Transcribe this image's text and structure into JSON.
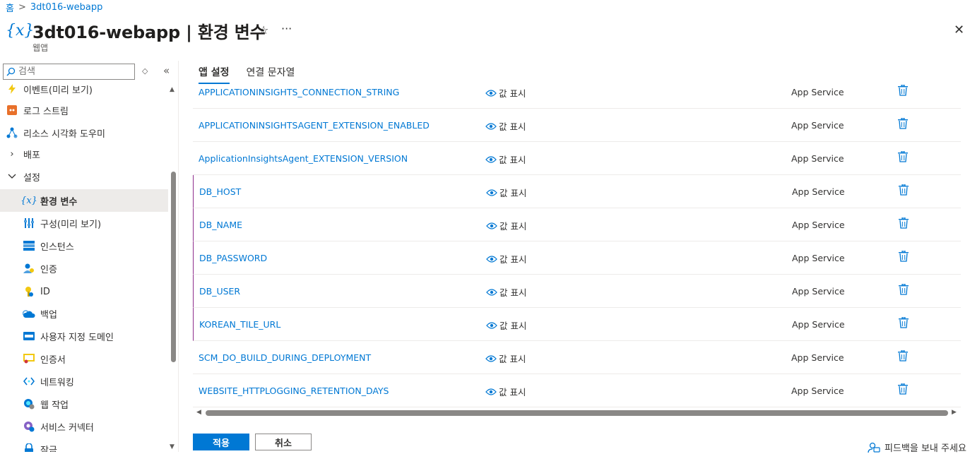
{
  "breadcrumb": {
    "home": "홈",
    "separator": ">",
    "current": "3dt016-webapp"
  },
  "header": {
    "icon_glyph": "{x}",
    "title": "3dt016-webapp | 환경 변수",
    "subtitle": "웹앱",
    "star_glyph": "☆",
    "more_glyph": "···",
    "close_glyph": "✕"
  },
  "search": {
    "placeholder": "검색"
  },
  "nav": {
    "items": [
      {
        "label": "이벤트(미리 보기)",
        "icon": "lightning-icon"
      },
      {
        "label": "로그 스트림",
        "icon": "log-stream-icon"
      },
      {
        "label": "리소스 시각화 도우미",
        "icon": "resource-visualizer-icon"
      },
      {
        "label": "배포",
        "icon": "chevron-right-icon",
        "group": true
      },
      {
        "label": "설정",
        "icon": "chevron-down-icon",
        "group": true
      },
      {
        "label": "환경 변수",
        "icon": "variable-icon",
        "selected": true
      },
      {
        "label": "구성(미리 보기)",
        "icon": "configuration-icon"
      },
      {
        "label": "인스턴스",
        "icon": "instance-icon"
      },
      {
        "label": "인증",
        "icon": "authentication-icon"
      },
      {
        "label": "ID",
        "icon": "identity-icon"
      },
      {
        "label": "백업",
        "icon": "backup-icon"
      },
      {
        "label": "사용자 지정 도메인",
        "icon": "custom-domain-icon"
      },
      {
        "label": "인증서",
        "icon": "certificate-icon"
      },
      {
        "label": "네트워킹",
        "icon": "networking-icon"
      },
      {
        "label": "웹 작업",
        "icon": "webjob-icon"
      },
      {
        "label": "서비스 커넥터",
        "icon": "service-connector-icon"
      },
      {
        "label": "잠금",
        "icon": "lock-icon"
      }
    ]
  },
  "tabs": [
    {
      "label": "앱 설정",
      "active": true
    },
    {
      "label": "연결 문자열",
      "active": false
    }
  ],
  "settings": {
    "value_label": "값 표시",
    "source": "App Service",
    "rows": [
      {
        "name": "APPLICATIONINSIGHTS_CONNECTION_STRING",
        "modified": false
      },
      {
        "name": "APPLICATIONINSIGHTSAGENT_EXTENSION_ENABLED",
        "modified": false
      },
      {
        "name": "ApplicationInsightsAgent_EXTENSION_VERSION",
        "modified": false
      },
      {
        "name": "DB_HOST",
        "modified": true
      },
      {
        "name": "DB_NAME",
        "modified": true
      },
      {
        "name": "DB_PASSWORD",
        "modified": true
      },
      {
        "name": "DB_USER",
        "modified": true
      },
      {
        "name": "KOREAN_TILE_URL",
        "modified": true
      },
      {
        "name": "SCM_DO_BUILD_DURING_DEPLOYMENT",
        "modified": false
      },
      {
        "name": "WEBSITE_HTTPLOGGING_RETENTION_DAYS",
        "modified": false
      }
    ]
  },
  "footer": {
    "apply": "적용",
    "cancel": "취소",
    "feedback": "피드백을 보내 주세요"
  },
  "colors": {
    "accent": "#0078d4",
    "modified_marker": "#8f2d8d"
  }
}
